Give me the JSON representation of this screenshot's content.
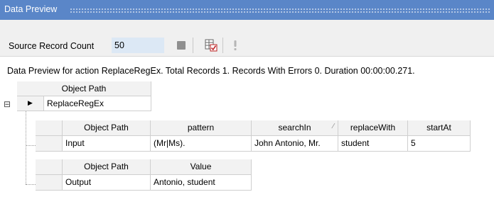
{
  "window": {
    "title": "Data Preview"
  },
  "toolbar": {
    "source_label": "Source Record Count",
    "source_count": "50"
  },
  "status": "Data Preview for action ReplaceRegEx. Total Records 1. Records With Errors 0. Duration 00:00:00.271.",
  "root": {
    "header": "Object Path",
    "expand_symbol": "⊟",
    "row_arrow": "▶",
    "value": "ReplaceRegEx"
  },
  "input_table": {
    "headers": [
      "Object Path",
      "pattern",
      "searchIn",
      "replaceWith",
      "startAt"
    ],
    "row": [
      "Input",
      "(Mr|Ms).",
      "John Antonio, Mr.",
      "student",
      "5"
    ]
  },
  "output_table": {
    "headers": [
      "Object Path",
      "Value"
    ],
    "row": [
      "Output",
      "Antonio, student"
    ]
  }
}
